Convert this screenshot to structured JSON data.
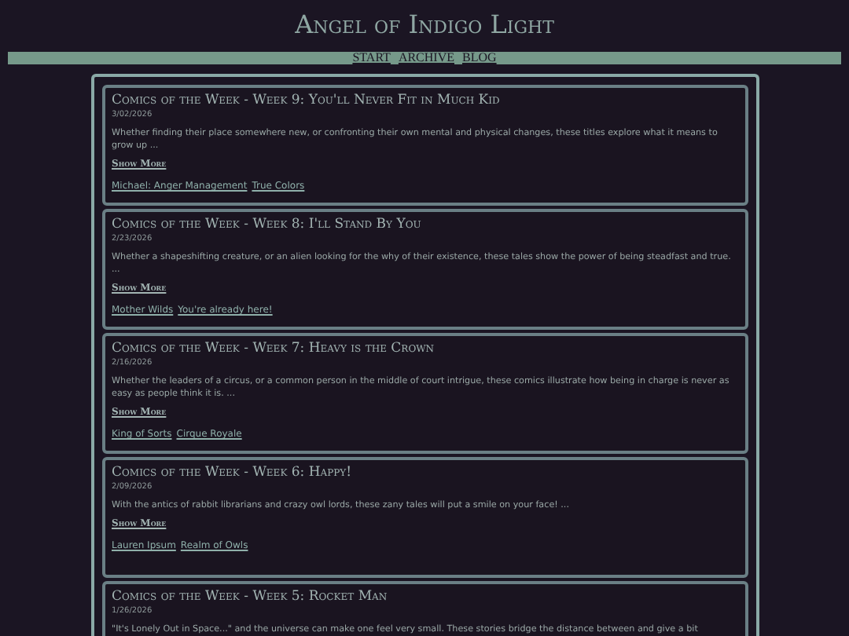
{
  "site_title": "Angel of Indigo Light",
  "nav": [
    "START",
    "ARCHIVE",
    "BLOG"
  ],
  "posts": [
    {
      "title": "Comics of the Week - Week 9: You'll Never Fit in Much Kid",
      "date": "3/02/2026",
      "summary": "Whether finding their place somewhere new, or confronting their own mental and physical changes, these titles explore what it means to grow up ...",
      "show_more": "Show More",
      "links": [
        "Michael: Anger Management",
        "True Colors"
      ]
    },
    {
      "title": "Comics of the Week - Week 8: I'll Stand By You",
      "date": "2/23/2026",
      "summary": "Whether a shapeshifting creature, or an alien looking for the why of their existence, these tales show the power of being steadfast and true. ...",
      "show_more": "Show More",
      "links": [
        "Mother Wilds",
        "You're already here!"
      ]
    },
    {
      "title": "Comics of the Week - Week 7: Heavy is the Crown",
      "date": "2/16/2026",
      "summary": "Whether the leaders of a circus, or a common person in the middle of court intrigue, these comics illustrate how being in charge is never as easy as people think it is. ...",
      "show_more": "Show More",
      "links": [
        "King of Sorts",
        "Cirque Royale"
      ]
    },
    {
      "title": "Comics of the Week - Week 6: Happy!",
      "date": "2/09/2026",
      "summary": "With the antics of rabbit librarians and crazy owl lords, these zany tales will put a smile on your face! ...",
      "show_more": "Show More",
      "links": [
        "Lauren Ipsum",
        "Realm of Owls"
      ]
    },
    {
      "title": "Comics of the Week - Week 5: Rocket Man",
      "date": "1/26/2026",
      "summary": "\"It's Lonely Out in Space...\" and the universe can make one feel very small. These stories bridge the distance between and give a bit"
    }
  ]
}
